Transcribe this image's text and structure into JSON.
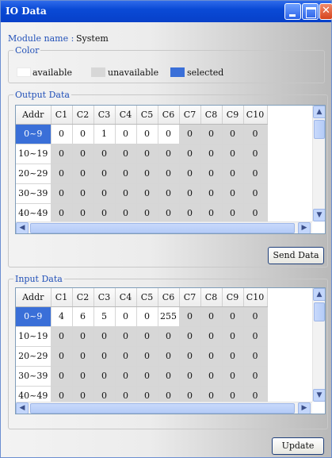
{
  "window": {
    "title": "IO Data"
  },
  "module": {
    "label": "Module name :",
    "value": "System"
  },
  "legend": {
    "title": "Color",
    "items": [
      {
        "label": "available",
        "color": "#ffffff"
      },
      {
        "label": "unavailable",
        "color": "#d7d7d7"
      },
      {
        "label": "selected",
        "color": "#3a6fd8"
      }
    ]
  },
  "output": {
    "title": "Output Data",
    "columns": [
      "Addr",
      "C1",
      "C2",
      "C3",
      "C4",
      "C5",
      "C6",
      "C7",
      "C8",
      "C9",
      "C10"
    ],
    "rows": [
      {
        "addr": "0~9",
        "values": [
          "0",
          "0",
          "1",
          "0",
          "0",
          "0",
          "0",
          "0",
          "0",
          "0"
        ]
      },
      {
        "addr": "10~19",
        "values": [
          "0",
          "0",
          "0",
          "0",
          "0",
          "0",
          "0",
          "0",
          "0",
          "0"
        ]
      },
      {
        "addr": "20~29",
        "values": [
          "0",
          "0",
          "0",
          "0",
          "0",
          "0",
          "0",
          "0",
          "0",
          "0"
        ]
      },
      {
        "addr": "30~39",
        "values": [
          "0",
          "0",
          "0",
          "0",
          "0",
          "0",
          "0",
          "0",
          "0",
          "0"
        ]
      },
      {
        "addr": "40~49",
        "values": [
          "0",
          "0",
          "0",
          "0",
          "0",
          "0",
          "0",
          "0",
          "0",
          "0"
        ]
      }
    ],
    "button": "Send Data"
  },
  "input": {
    "title": "Input Data",
    "columns": [
      "Addr",
      "C1",
      "C2",
      "C3",
      "C4",
      "C5",
      "C6",
      "C7",
      "C8",
      "C9",
      "C10"
    ],
    "rows": [
      {
        "addr": "0~9",
        "values": [
          "4",
          "6",
          "5",
          "0",
          "0",
          "255",
          "0",
          "0",
          "0",
          "0"
        ]
      },
      {
        "addr": "10~19",
        "values": [
          "0",
          "0",
          "0",
          "0",
          "0",
          "0",
          "0",
          "0",
          "0",
          "0"
        ]
      },
      {
        "addr": "20~29",
        "values": [
          "0",
          "0",
          "0",
          "0",
          "0",
          "0",
          "0",
          "0",
          "0",
          "0"
        ]
      },
      {
        "addr": "30~39",
        "values": [
          "0",
          "0",
          "0",
          "0",
          "0",
          "0",
          "0",
          "0",
          "0",
          "0"
        ]
      },
      {
        "addr": "40~49",
        "values": [
          "0",
          "0",
          "0",
          "0",
          "0",
          "0",
          "0",
          "0",
          "0",
          "0"
        ]
      }
    ],
    "button": "Update"
  }
}
